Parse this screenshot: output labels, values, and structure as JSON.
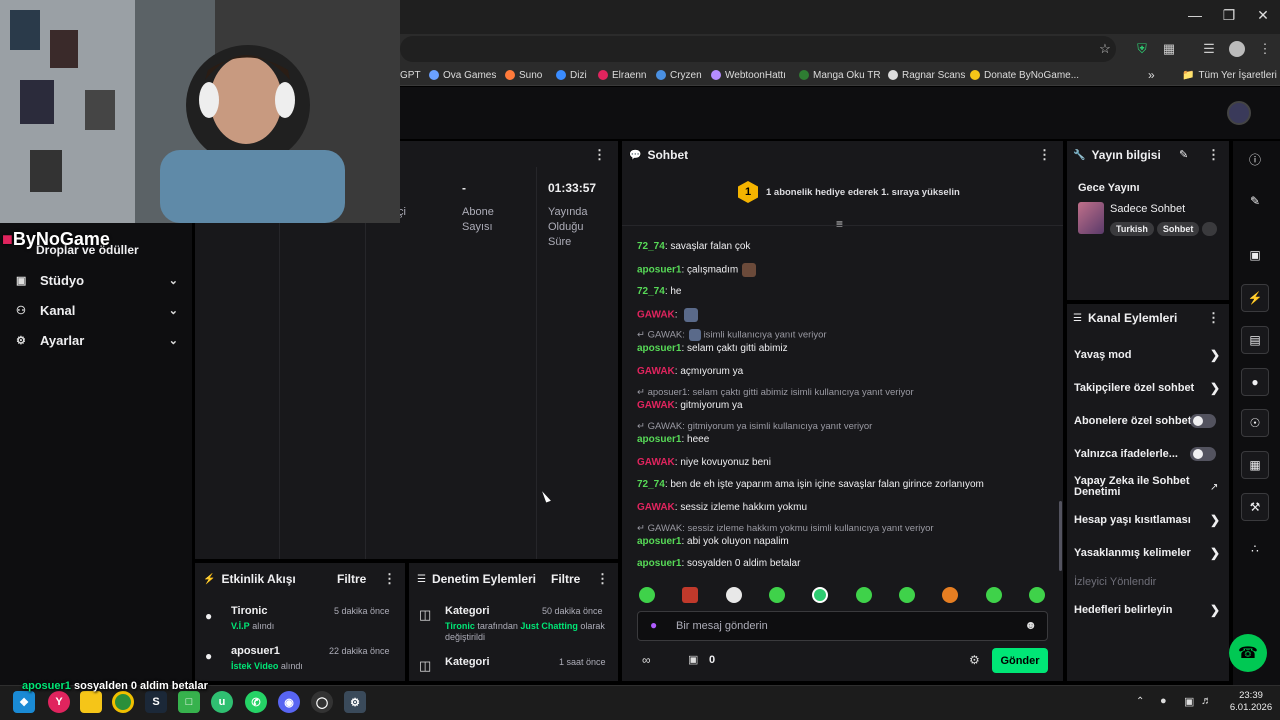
{
  "bookmarks": [
    {
      "label": "GPT",
      "color": "#cccccc"
    },
    {
      "label": "Ova Games",
      "color": "#6aa0ff"
    },
    {
      "label": "Suno",
      "color": "#ff7a3a"
    },
    {
      "label": "Dizi",
      "color": "#3a8cff"
    },
    {
      "label": "Elraenn",
      "color": "#e0245e"
    },
    {
      "label": "Cryzen",
      "color": "#4a90e2"
    },
    {
      "label": "WebtoonHattı",
      "color": "#b58cff"
    },
    {
      "label": "Manga Oku TR",
      "color": "#2e7d32"
    },
    {
      "label": "Ragnar Scans",
      "color": "#dddddd"
    },
    {
      "label": "Donate ByNoGame...",
      "color": "#f5c518"
    }
  ],
  "bookmarks_more": "»",
  "bookmarks_folder": "Tüm Yer İşaretleri",
  "sidebar": {
    "logo_text": "ByNoGame",
    "partial_item": "Droplar ve ödüller",
    "items": [
      {
        "label": "Stüdyo"
      },
      {
        "label": "Kanal"
      },
      {
        "label": "Ayarlar"
      }
    ]
  },
  "stats": {
    "col1_label": "çi",
    "col2_value": "-",
    "col2_label": "Abone Sayısı",
    "col3_value": "01:33:57",
    "col3_label": "Yayında Olduğu Süre"
  },
  "chat": {
    "title": "Sohbet",
    "pinned_rank": "1",
    "pinned_text": "1 abonelik hediye ederek 1. sıraya yükselin",
    "messages": [
      {
        "user": "72_74",
        "user_color": "#57d957",
        "text": "savaşlar falan çok"
      },
      {
        "user": "aposuer1",
        "user_color": "#57d957",
        "text": "çalışmadım"
      },
      {
        "user": "72_74",
        "user_color": "#57d957",
        "text": "he"
      },
      {
        "user": "GAWAK",
        "user_color": "#e0245e",
        "text": ""
      },
      {
        "user": "aposuer1",
        "user_color": "#57d957",
        "text": "selam çaktı gitti abimiz"
      },
      {
        "user": "GAWAK",
        "user_color": "#e0245e",
        "text": "açmıyorum ya"
      },
      {
        "user": "GAWAK",
        "user_color": "#e0245e",
        "text": "gitmiyorum ya"
      },
      {
        "user": "aposuer1",
        "user_color": "#57d957",
        "text": "heee"
      },
      {
        "user": "GAWAK",
        "user_color": "#e0245e",
        "text": "niye kovuyonuz beni"
      },
      {
        "user": "72_74",
        "user_color": "#57d957",
        "text": "ben de eh işte yaparım ama işin içine savaşlar falan girince zorlanıyom"
      },
      {
        "user": "GAWAK",
        "user_color": "#e0245e",
        "text": "sessiz izleme hakkım yokmu"
      },
      {
        "user": "aposuer1",
        "user_color": "#57d957",
        "text": "abi yok oluyon napalim"
      },
      {
        "user": "aposuer1",
        "user_color": "#57d957",
        "text": "sosyalden 0 aldim betalar"
      }
    ],
    "replies": [
      {
        "text": "GAWAK:",
        "suffix": "isimli kullanıcıya yanıt veriyor"
      },
      {
        "text": "aposuer1: selam çaktı gitti abimiz isimli kullanıcıya yanıt veriyor"
      },
      {
        "text": "GAWAK: gitmiyorum ya isimli kullanıcıya yanıt veriyor"
      },
      {
        "text": "GAWAK: sessiz izleme hakkım yokmu isimli kullanıcıya yanıt veriyor"
      }
    ],
    "input_placeholder": "Bir mesaj gönderin",
    "points": "0",
    "send_label": "Gönder"
  },
  "activity": {
    "title": "Etkinlik Akışı",
    "filter": "Filtre",
    "items": [
      {
        "name": "Tironic",
        "highlight": "V.İ.P",
        "rest": "alındı",
        "time": "5 dakika önce"
      },
      {
        "name": "aposuer1",
        "highlight": "İstek Video",
        "rest": "alındı",
        "time": "22 dakika önce"
      }
    ]
  },
  "moderation": {
    "title": "Denetim Eylemleri",
    "filter": "Filtre",
    "items": [
      {
        "name": "Kategori",
        "user": "Tironic",
        "mid": "tarafından",
        "highlight": "Just Chatting",
        "rest": "olarak değiştirildi",
        "time": "50 dakika önce"
      },
      {
        "name": "Kategori",
        "time": "1 saat önce"
      }
    ]
  },
  "stream_info": {
    "title": "Yayın bilgisi",
    "stream_title": "Gece Yayını",
    "category": "Sadece Sohbet",
    "tags": [
      "Turkish",
      "Sohbet"
    ]
  },
  "channel_actions": {
    "title": "Kanal Eylemleri",
    "items": [
      {
        "label": "Yavaş mod"
      },
      {
        "label": "Takipçilere özel sohbet"
      },
      {
        "label": "Abonelere özel sohbet"
      },
      {
        "label": "Yalnızca ifadelerle..."
      },
      {
        "label": "Yapay Zeka ile Sohbet Denetimi"
      },
      {
        "label": "Hesap yaşı kısıtlaması"
      },
      {
        "label": "Yasaklanmış kelimeler"
      },
      {
        "label": "İzleyici Yönlendir"
      },
      {
        "label": "Hedefleri belirleyin"
      }
    ]
  },
  "overlay": {
    "user": "aposuer1",
    "text": "sosyalden 0 aldim betalar"
  },
  "taskbar": {
    "time": "23:39",
    "date": "6.01.2026"
  },
  "colors": {
    "accent": "#00e676",
    "panel": "#18181b",
    "bg": "#0e0e10"
  }
}
